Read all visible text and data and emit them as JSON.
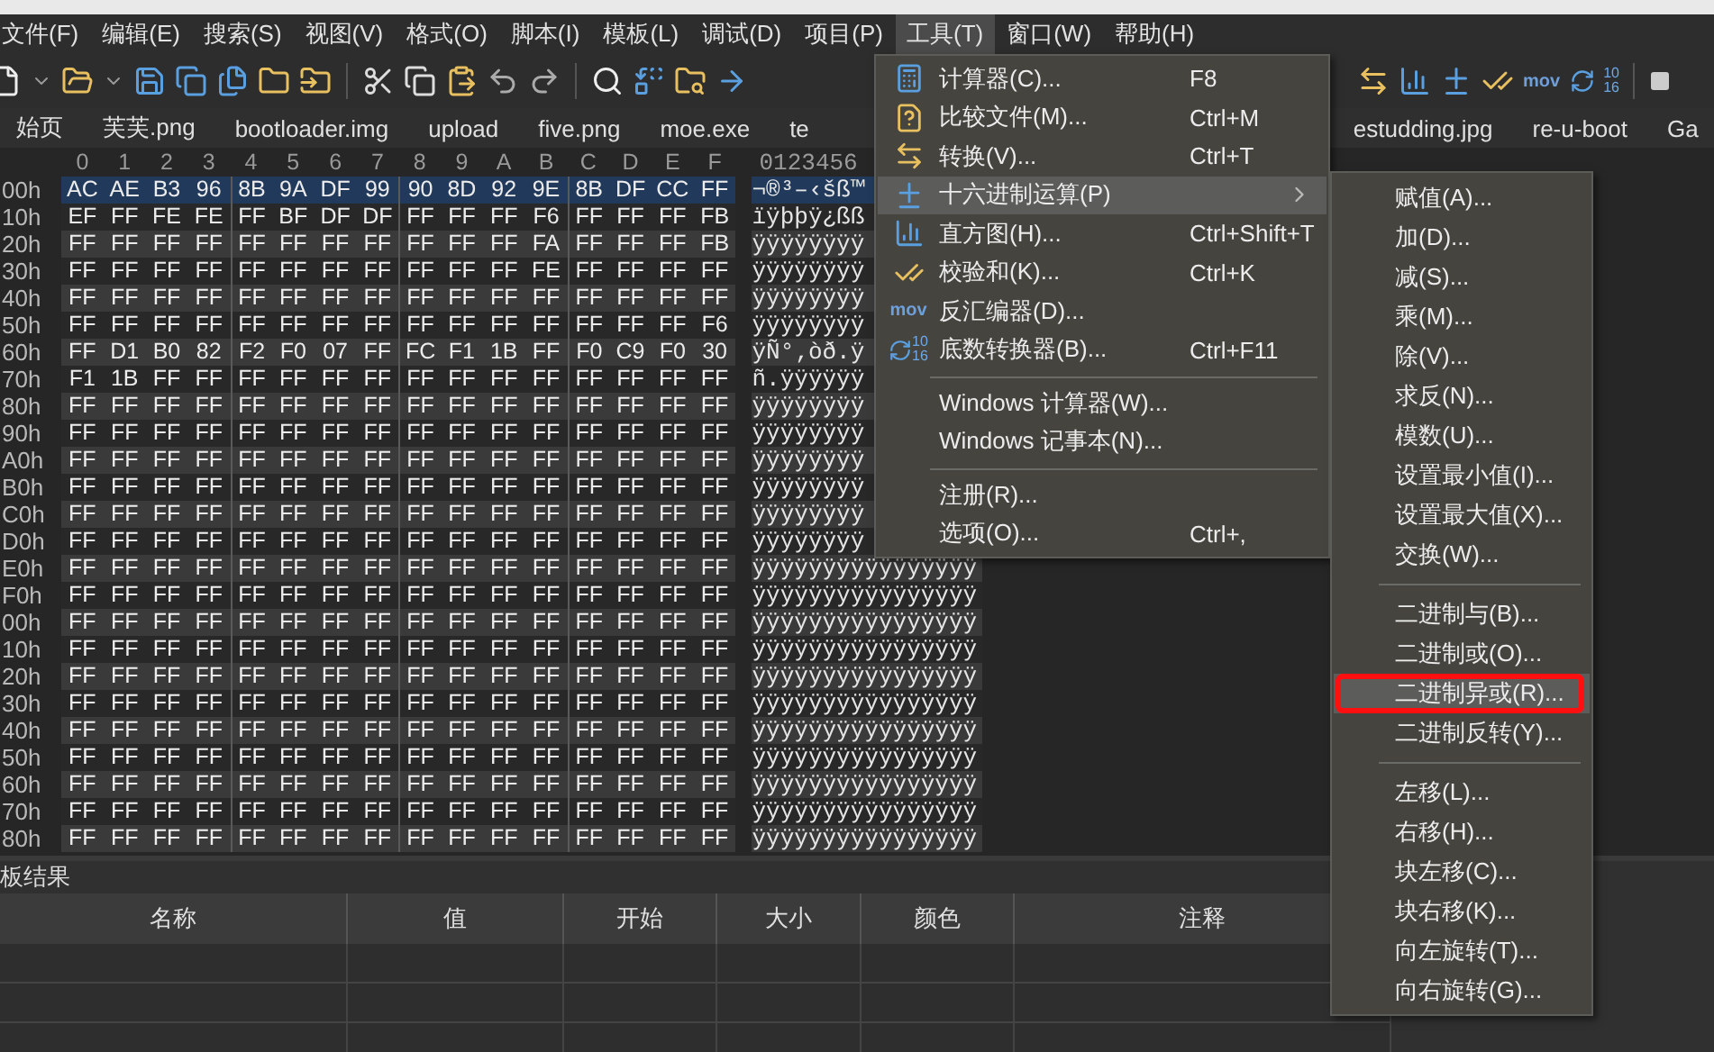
{
  "menubar": [
    {
      "label": "文件(F)",
      "selected": false
    },
    {
      "label": "编辑(E)",
      "selected": false
    },
    {
      "label": "搜索(S)",
      "selected": false
    },
    {
      "label": "视图(V)",
      "selected": false
    },
    {
      "label": "格式(O)",
      "selected": false
    },
    {
      "label": "脚本(I)",
      "selected": false
    },
    {
      "label": "模板(L)",
      "selected": false
    },
    {
      "label": "调试(D)",
      "selected": false
    },
    {
      "label": "项目(P)",
      "selected": false
    },
    {
      "label": "工具(T)",
      "selected": true
    },
    {
      "label": "窗口(W)",
      "selected": false
    },
    {
      "label": "帮助(H)",
      "selected": false
    }
  ],
  "toolbar": {
    "mov_label": "mov",
    "base_labels": [
      "10",
      "16"
    ]
  },
  "tabs": [
    {
      "label": "始页"
    },
    {
      "label": "芙芙.png"
    },
    {
      "label": "bootloader.img"
    },
    {
      "label": "upload"
    },
    {
      "label": "five.png"
    },
    {
      "label": "moe.exe"
    },
    {
      "label": "te"
    },
    {
      "label": "estudding.jpg"
    },
    {
      "label": "re-u-boot"
    },
    {
      "label": "Ga"
    }
  ],
  "hex_editor": {
    "column_header": [
      "0",
      "1",
      "2",
      "3",
      "4",
      "5",
      "6",
      "7",
      "8",
      "9",
      "A",
      "B",
      "C",
      "D",
      "E",
      "F"
    ],
    "ascii_header": "0123456",
    "rows": [
      {
        "offset": "00h",
        "selected": true,
        "bytes": [
          "AC",
          "AE",
          "B3",
          "96",
          "8B",
          "9A",
          "DF",
          "99",
          "90",
          "8D",
          "92",
          "9E",
          "8B",
          "DF",
          "CC",
          "FF"
        ],
        "ascii": "¬®³–‹šß™"
      },
      {
        "offset": "10h",
        "selected": false,
        "bytes": [
          "EF",
          "FF",
          "FE",
          "FE",
          "FF",
          "BF",
          "DF",
          "DF",
          "FF",
          "FF",
          "FF",
          "F6",
          "FF",
          "FF",
          "FF",
          "FB"
        ],
        "ascii": "ïÿþþÿ¿ßß"
      },
      {
        "offset": "20h",
        "selected": false,
        "bytes": [
          "FF",
          "FF",
          "FF",
          "FF",
          "FF",
          "FF",
          "FF",
          "FF",
          "FF",
          "FF",
          "FF",
          "FA",
          "FF",
          "FF",
          "FF",
          "FB"
        ],
        "ascii": "ÿÿÿÿÿÿÿÿ"
      },
      {
        "offset": "30h",
        "selected": false,
        "bytes": [
          "FF",
          "FF",
          "FF",
          "FF",
          "FF",
          "FF",
          "FF",
          "FF",
          "FF",
          "FF",
          "FF",
          "FE",
          "FF",
          "FF",
          "FF",
          "FF"
        ],
        "ascii": "ÿÿÿÿÿÿÿÿ"
      },
      {
        "offset": "40h",
        "selected": false,
        "bytes": [
          "FF",
          "FF",
          "FF",
          "FF",
          "FF",
          "FF",
          "FF",
          "FF",
          "FF",
          "FF",
          "FF",
          "FF",
          "FF",
          "FF",
          "FF",
          "FF"
        ],
        "ascii": "ÿÿÿÿÿÿÿÿ"
      },
      {
        "offset": "50h",
        "selected": false,
        "bytes": [
          "FF",
          "FF",
          "FF",
          "FF",
          "FF",
          "FF",
          "FF",
          "FF",
          "FF",
          "FF",
          "FF",
          "FF",
          "FF",
          "FF",
          "FF",
          "F6"
        ],
        "ascii": "ÿÿÿÿÿÿÿÿ"
      },
      {
        "offset": "60h",
        "selected": false,
        "bytes": [
          "FF",
          "D1",
          "B0",
          "82",
          "F2",
          "F0",
          "07",
          "FF",
          "FC",
          "F1",
          "1B",
          "FF",
          "F0",
          "C9",
          "F0",
          "30"
        ],
        "ascii": "ÿÑ°‚òð.ÿ"
      },
      {
        "offset": "70h",
        "selected": false,
        "bytes": [
          "F1",
          "1B",
          "FF",
          "FF",
          "FF",
          "FF",
          "FF",
          "FF",
          "FF",
          "FF",
          "FF",
          "FF",
          "FF",
          "FF",
          "FF",
          "FF"
        ],
        "ascii": "ñ.ÿÿÿÿÿÿ"
      },
      {
        "offset": "80h",
        "selected": false,
        "bytes": [
          "FF",
          "FF",
          "FF",
          "FF",
          "FF",
          "FF",
          "FF",
          "FF",
          "FF",
          "FF",
          "FF",
          "FF",
          "FF",
          "FF",
          "FF",
          "FF"
        ],
        "ascii": "ÿÿÿÿÿÿÿÿ"
      },
      {
        "offset": "90h",
        "selected": false,
        "bytes": [
          "FF",
          "FF",
          "FF",
          "FF",
          "FF",
          "FF",
          "FF",
          "FF",
          "FF",
          "FF",
          "FF",
          "FF",
          "FF",
          "FF",
          "FF",
          "FF"
        ],
        "ascii": "ÿÿÿÿÿÿÿÿ"
      },
      {
        "offset": "A0h",
        "selected": false,
        "bytes": [
          "FF",
          "FF",
          "FF",
          "FF",
          "FF",
          "FF",
          "FF",
          "FF",
          "FF",
          "FF",
          "FF",
          "FF",
          "FF",
          "FF",
          "FF",
          "FF"
        ],
        "ascii": "ÿÿÿÿÿÿÿÿ"
      },
      {
        "offset": "B0h",
        "selected": false,
        "bytes": [
          "FF",
          "FF",
          "FF",
          "FF",
          "FF",
          "FF",
          "FF",
          "FF",
          "FF",
          "FF",
          "FF",
          "FF",
          "FF",
          "FF",
          "FF",
          "FF"
        ],
        "ascii": "ÿÿÿÿÿÿÿÿ"
      },
      {
        "offset": "C0h",
        "selected": false,
        "bytes": [
          "FF",
          "FF",
          "FF",
          "FF",
          "FF",
          "FF",
          "FF",
          "FF",
          "FF",
          "FF",
          "FF",
          "FF",
          "FF",
          "FF",
          "FF",
          "FF"
        ],
        "ascii": "ÿÿÿÿÿÿÿÿ"
      },
      {
        "offset": "D0h",
        "selected": false,
        "bytes": [
          "FF",
          "FF",
          "FF",
          "FF",
          "FF",
          "FF",
          "FF",
          "FF",
          "FF",
          "FF",
          "FF",
          "FF",
          "FF",
          "FF",
          "FF",
          "FF"
        ],
        "ascii": "ÿÿÿÿÿÿÿÿ"
      },
      {
        "offset": "E0h",
        "selected": false,
        "bytes": [
          "FF",
          "FF",
          "FF",
          "FF",
          "FF",
          "FF",
          "FF",
          "FF",
          "FF",
          "FF",
          "FF",
          "FF",
          "FF",
          "FF",
          "FF",
          "FF"
        ],
        "ascii": "ÿÿÿÿÿÿÿÿÿÿÿÿÿÿÿÿ"
      },
      {
        "offset": "F0h",
        "selected": false,
        "bytes": [
          "FF",
          "FF",
          "FF",
          "FF",
          "FF",
          "FF",
          "FF",
          "FF",
          "FF",
          "FF",
          "FF",
          "FF",
          "FF",
          "FF",
          "FF",
          "FF"
        ],
        "ascii": "ÿÿÿÿÿÿÿÿÿÿÿÿÿÿÿÿ"
      },
      {
        "offset": "00h",
        "selected": false,
        "bytes": [
          "FF",
          "FF",
          "FF",
          "FF",
          "FF",
          "FF",
          "FF",
          "FF",
          "FF",
          "FF",
          "FF",
          "FF",
          "FF",
          "FF",
          "FF",
          "FF"
        ],
        "ascii": "ÿÿÿÿÿÿÿÿÿÿÿÿÿÿÿÿ"
      },
      {
        "offset": "10h",
        "selected": false,
        "bytes": [
          "FF",
          "FF",
          "FF",
          "FF",
          "FF",
          "FF",
          "FF",
          "FF",
          "FF",
          "FF",
          "FF",
          "FF",
          "FF",
          "FF",
          "FF",
          "FF"
        ],
        "ascii": "ÿÿÿÿÿÿÿÿÿÿÿÿÿÿÿÿ"
      },
      {
        "offset": "20h",
        "selected": false,
        "bytes": [
          "FF",
          "FF",
          "FF",
          "FF",
          "FF",
          "FF",
          "FF",
          "FF",
          "FF",
          "FF",
          "FF",
          "FF",
          "FF",
          "FF",
          "FF",
          "FF"
        ],
        "ascii": "ÿÿÿÿÿÿÿÿÿÿÿÿÿÿÿÿ"
      },
      {
        "offset": "30h",
        "selected": false,
        "bytes": [
          "FF",
          "FF",
          "FF",
          "FF",
          "FF",
          "FF",
          "FF",
          "FF",
          "FF",
          "FF",
          "FF",
          "FF",
          "FF",
          "FF",
          "FF",
          "FF"
        ],
        "ascii": "ÿÿÿÿÿÿÿÿÿÿÿÿÿÿÿÿ"
      },
      {
        "offset": "40h",
        "selected": false,
        "bytes": [
          "FF",
          "FF",
          "FF",
          "FF",
          "FF",
          "FF",
          "FF",
          "FF",
          "FF",
          "FF",
          "FF",
          "FF",
          "FF",
          "FF",
          "FF",
          "FF"
        ],
        "ascii": "ÿÿÿÿÿÿÿÿÿÿÿÿÿÿÿÿ"
      },
      {
        "offset": "50h",
        "selected": false,
        "bytes": [
          "FF",
          "FF",
          "FF",
          "FF",
          "FF",
          "FF",
          "FF",
          "FF",
          "FF",
          "FF",
          "FF",
          "FF",
          "FF",
          "FF",
          "FF",
          "FF"
        ],
        "ascii": "ÿÿÿÿÿÿÿÿÿÿÿÿÿÿÿÿ"
      },
      {
        "offset": "60h",
        "selected": false,
        "bytes": [
          "FF",
          "FF",
          "FF",
          "FF",
          "FF",
          "FF",
          "FF",
          "FF",
          "FF",
          "FF",
          "FF",
          "FF",
          "FF",
          "FF",
          "FF",
          "FF"
        ],
        "ascii": "ÿÿÿÿÿÿÿÿÿÿÿÿÿÿÿÿ"
      },
      {
        "offset": "70h",
        "selected": false,
        "bytes": [
          "FF",
          "FF",
          "FF",
          "FF",
          "FF",
          "FF",
          "FF",
          "FF",
          "FF",
          "FF",
          "FF",
          "FF",
          "FF",
          "FF",
          "FF",
          "FF"
        ],
        "ascii": "ÿÿÿÿÿÿÿÿÿÿÿÿÿÿÿÿ"
      },
      {
        "offset": "80h",
        "selected": false,
        "bytes": [
          "FF",
          "FF",
          "FF",
          "FF",
          "FF",
          "FF",
          "FF",
          "FF",
          "FF",
          "FF",
          "FF",
          "FF",
          "FF",
          "FF",
          "FF",
          "FF"
        ],
        "ascii": "ÿÿÿÿÿÿÿÿÿÿÿÿÿÿÿÿ"
      }
    ]
  },
  "tools_menu": {
    "items": [
      {
        "kind": "item",
        "label": "计算器(C)...",
        "shortcut": "F8",
        "highlighted": false
      },
      {
        "kind": "item",
        "label": "比较文件(M)...",
        "shortcut": "Ctrl+M",
        "highlighted": false
      },
      {
        "kind": "item",
        "label": "转换(V)...",
        "shortcut": "Ctrl+T",
        "highlighted": false
      },
      {
        "kind": "submenu",
        "label": "十六进制运算(P)",
        "highlighted": true
      },
      {
        "kind": "item",
        "label": "直方图(H)...",
        "shortcut": "Ctrl+Shift+T",
        "highlighted": false
      },
      {
        "kind": "item",
        "label": "校验和(K)...",
        "shortcut": "Ctrl+K",
        "highlighted": false
      },
      {
        "kind": "item",
        "icon_text": "mov",
        "label": "反汇编器(D)...",
        "highlighted": false
      },
      {
        "kind": "item",
        "icon_labels": [
          "10",
          "16"
        ],
        "label": "底数转换器(B)...",
        "shortcut": "Ctrl+F11",
        "highlighted": false
      },
      {
        "kind": "separator"
      },
      {
        "kind": "item",
        "label": "Windows 计算器(W)...",
        "highlighted": false
      },
      {
        "kind": "item",
        "label": "Windows 记事本(N)...",
        "highlighted": false
      },
      {
        "kind": "separator"
      },
      {
        "kind": "item",
        "label": "注册(R)...",
        "highlighted": false
      },
      {
        "kind": "item",
        "label": "选项(O)...",
        "shortcut": "Ctrl+,",
        "highlighted": false
      }
    ]
  },
  "hex_ops_submenu": {
    "items": [
      {
        "kind": "item",
        "label": "赋值(A)...",
        "highlighted": false,
        "outlined": false
      },
      {
        "kind": "item",
        "label": "加(D)...",
        "highlighted": false,
        "outlined": false
      },
      {
        "kind": "item",
        "label": "减(S)...",
        "highlighted": false,
        "outlined": false
      },
      {
        "kind": "item",
        "label": "乘(M)...",
        "highlighted": false,
        "outlined": false
      },
      {
        "kind": "item",
        "label": "除(V)...",
        "highlighted": false,
        "outlined": false
      },
      {
        "kind": "item",
        "label": "求反(N)...",
        "highlighted": false,
        "outlined": false
      },
      {
        "kind": "item",
        "label": "模数(U)...",
        "highlighted": false,
        "outlined": false
      },
      {
        "kind": "item",
        "label": "设置最小值(I)...",
        "highlighted": false,
        "outlined": false
      },
      {
        "kind": "item",
        "label": "设置最大值(X)...",
        "highlighted": false,
        "outlined": false
      },
      {
        "kind": "item",
        "label": "交换(W)...",
        "highlighted": false,
        "outlined": false
      },
      {
        "kind": "separator"
      },
      {
        "kind": "item",
        "label": "二进制与(B)...",
        "highlighted": false,
        "outlined": false
      },
      {
        "kind": "item",
        "label": "二进制或(O)...",
        "highlighted": false,
        "outlined": false
      },
      {
        "kind": "item",
        "label": "二进制异或(R)...",
        "highlighted": true,
        "outlined": true
      },
      {
        "kind": "item",
        "label": "二进制反转(Y)...",
        "highlighted": false,
        "outlined": false
      },
      {
        "kind": "separator"
      },
      {
        "kind": "item",
        "label": "左移(L)...",
        "highlighted": false,
        "outlined": false
      },
      {
        "kind": "item",
        "label": "右移(H)...",
        "highlighted": false,
        "outlined": false
      },
      {
        "kind": "item",
        "label": "块左移(C)...",
        "highlighted": false,
        "outlined": false
      },
      {
        "kind": "item",
        "label": "块右移(K)...",
        "highlighted": false,
        "outlined": false
      },
      {
        "kind": "item",
        "label": "向左旋转(T)...",
        "highlighted": false,
        "outlined": false
      },
      {
        "kind": "item",
        "label": "向右旋转(G)...",
        "highlighted": false,
        "outlined": false
      }
    ]
  },
  "template_results": {
    "title": "板结果",
    "columns": [
      "名称",
      "值",
      "开始",
      "大小",
      "颜色",
      "注释"
    ]
  }
}
